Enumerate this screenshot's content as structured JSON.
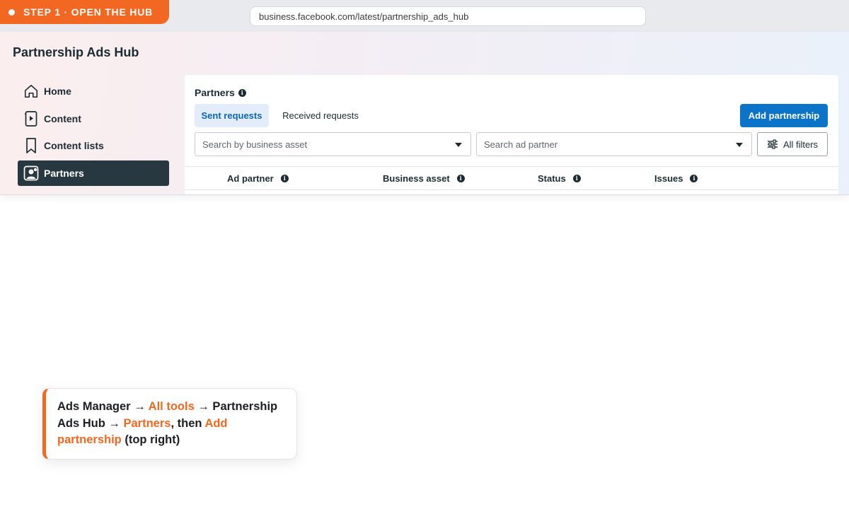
{
  "step_badge": {
    "label": "STEP 1 · OPEN THE HUB"
  },
  "browser": {
    "url": "business.facebook.com/latest/partnership_ads_hub"
  },
  "app": {
    "title": "Partnership Ads Hub"
  },
  "sidebar": {
    "items": [
      {
        "label": "Home",
        "icon": "home-icon",
        "active": false
      },
      {
        "label": "Content",
        "icon": "content-icon",
        "active": false
      },
      {
        "label": "Content lists",
        "icon": "bookmark-icon",
        "active": false
      },
      {
        "label": "Partners",
        "icon": "partners-icon",
        "active": true
      }
    ]
  },
  "main": {
    "heading": "Partners",
    "tabs": [
      {
        "label": "Sent requests",
        "selected": true
      },
      {
        "label": "Received requests",
        "selected": false
      }
    ],
    "add_button": "Add partnership",
    "filters": {
      "business_asset_placeholder": "Search by business asset",
      "ad_partner_placeholder": "Search ad partner",
      "all_filters_label": "All filters"
    },
    "table": {
      "columns": [
        "Ad partner",
        "Business asset",
        "Status",
        "Issues"
      ]
    }
  },
  "callout": {
    "part1": "Ads Manager → ",
    "part2": "All tools",
    "part3": " → Partnership Ads Hub → ",
    "part4": "Partners",
    "part5": ", then ",
    "part6": "Add partnership",
    "part7": " (top right)"
  },
  "colors": {
    "accent": "#f26722",
    "primary_button": "#0b73c8",
    "active_nav": "#283841",
    "selected_tab_bg": "#e2edf9"
  }
}
